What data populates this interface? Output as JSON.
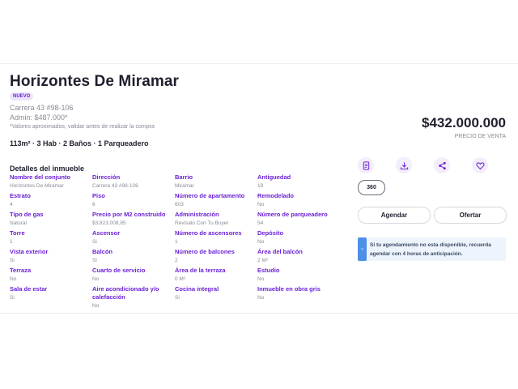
{
  "listing": {
    "title": "Horizontes De Miramar",
    "badge": "NUEVO",
    "address": "Carrera 43 #98-106",
    "admin": "Admin: $487.000*",
    "note": "*Valores aproximados, validar antes de realizar la compra",
    "specs": "113m² · 3 Hab · 2 Baños · 1 Parqueadero",
    "price": "$432.000.000",
    "price_label": "PRECIO DE VENTA"
  },
  "details": {
    "title": "Detalles del inmueble",
    "rows": [
      [
        {
          "k": "Nombre del conjunto",
          "v": "Horizontes De Miramar"
        },
        {
          "k": "Dirección",
          "v": "Carrera 43 #98-106"
        },
        {
          "k": "Barrio",
          "v": "Miramar"
        },
        {
          "k": "Antiguedad",
          "v": "19"
        }
      ],
      [
        {
          "k": "Estrato",
          "v": "4"
        },
        {
          "k": "Piso",
          "v": "6"
        },
        {
          "k": "Número de apartamento",
          "v": "603"
        },
        {
          "k": "Remodelado",
          "v": "No"
        }
      ],
      [
        {
          "k": "Tipo de gas",
          "v": "Natural"
        },
        {
          "k": "Precio por M2 construido",
          "v": "$3.823.008,85"
        },
        {
          "k": "Administración",
          "v": "Revisalo Con Tu Buyer"
        },
        {
          "k": "Número de parqueadero",
          "v": "54"
        }
      ],
      [
        {
          "k": "Torre",
          "v": "1"
        },
        {
          "k": "Ascensor",
          "v": "Si"
        },
        {
          "k": "Número de ascensores",
          "v": "1"
        },
        {
          "k": "Depósito",
          "v": "No"
        }
      ],
      [
        {
          "k": "Vista exterior",
          "v": "Si"
        },
        {
          "k": "Balcón",
          "v": "Si"
        },
        {
          "k": "Número de balcones",
          "v": "2"
        },
        {
          "k": "Área del balcón",
          "v": "2 M²"
        }
      ],
      [
        {
          "k": "Terraza",
          "v": "No"
        },
        {
          "k": "Cuarto de servicio",
          "v": "No"
        },
        {
          "k": "Área de la terraza",
          "v": "0 M²"
        },
        {
          "k": "Estudio",
          "v": "No"
        }
      ],
      [
        {
          "k": "Sala de estar",
          "v": "Si"
        },
        {
          "k": "Aire acondicionado y/o calefacción",
          "v": "No"
        },
        {
          "k": "Cocina integral",
          "v": "Si"
        },
        {
          "k": "Inmueble en obra gris",
          "v": "No"
        }
      ]
    ]
  },
  "actions": {
    "icons": [
      "document-icon",
      "download-icon",
      "share-icon",
      "heart-icon"
    ],
    "tour_label": "360",
    "agendar_label": "Agendar",
    "ofertar_label": "Ofertar",
    "info_text": "Si tu agendamiento no esta disponible, recuerda agendar con 4 horas de anticipación."
  },
  "colors": {
    "accent": "#6b21d6",
    "info": "#4d8fe8"
  }
}
